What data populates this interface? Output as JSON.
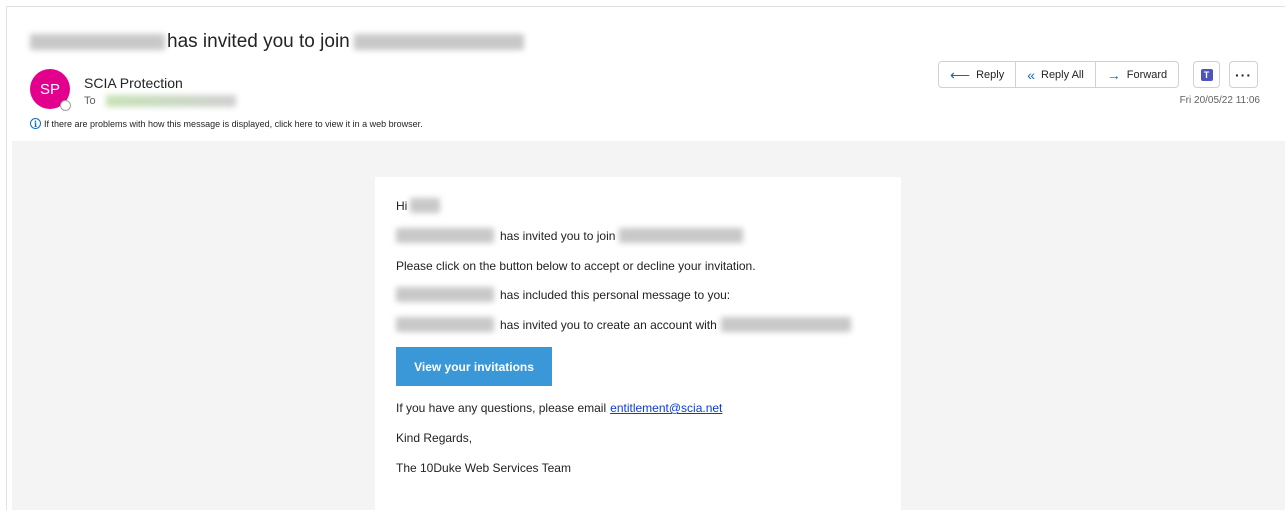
{
  "subject": {
    "text": "has invited you to join"
  },
  "sender": {
    "initials": "SP",
    "name": "SCIA Protection",
    "to_label": "To",
    "avatar_color": "#e3008c"
  },
  "info_bar": {
    "text": "If there are problems with how this message is displayed, click here to view it in a web browser."
  },
  "actions": {
    "reply": "Reply",
    "reply_all": "Reply All",
    "forward": "Forward"
  },
  "date": "Fri 20/05/22 11:06",
  "body": {
    "greeting": "Hi",
    "line1": "has invited you to join",
    "line2": "Please click on the button below to accept or decline your invitation.",
    "line3": "has included this personal message to you:",
    "line4": "has invited you to create an account with",
    "cta_label": "View your invitations",
    "cta_color": "#3b98d8",
    "questions_prefix": "If you have any questions, please email",
    "email_link": "entitlement@scia.net",
    "closing": "Kind Regards,",
    "signature": "The 10Duke Web Services Team"
  }
}
